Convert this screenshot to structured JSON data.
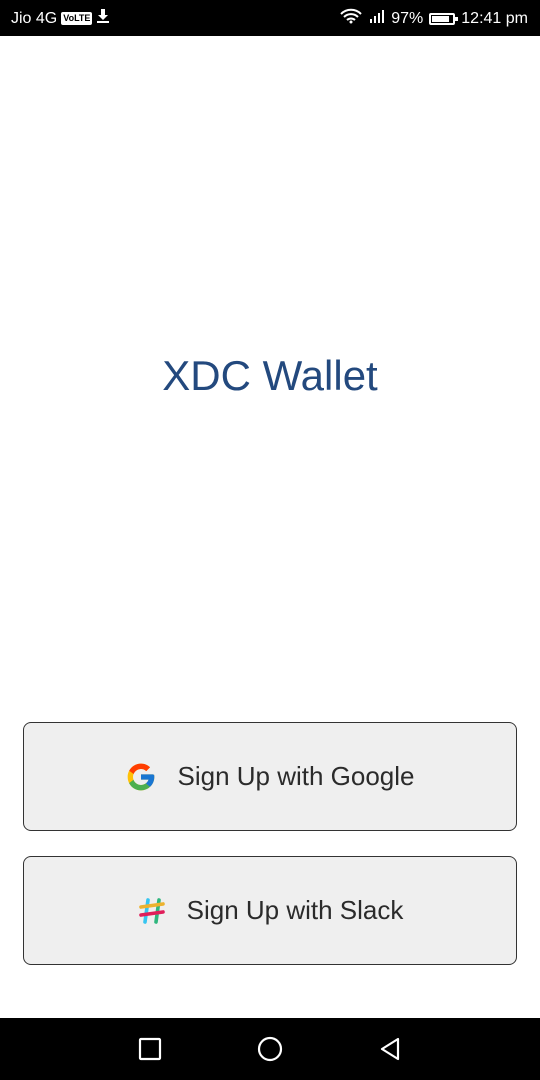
{
  "status_bar": {
    "carrier": "Jio 4G",
    "volte": "VoLTE",
    "battery_percent": "97%",
    "battery_level": 0.97,
    "time": "12:41 pm"
  },
  "app": {
    "title": "XDC Wallet"
  },
  "buttons": {
    "google_label": "Sign Up with Google",
    "slack_label": "Sign Up with Slack"
  },
  "icons": {
    "google": "google-logo-icon",
    "slack": "slack-logo-icon",
    "nav_recents": "square-icon",
    "nav_home": "circle-icon",
    "nav_back": "triangle-back-icon"
  },
  "colors": {
    "title": "#23497e",
    "button_bg": "#efefef",
    "button_border": "#333333"
  }
}
